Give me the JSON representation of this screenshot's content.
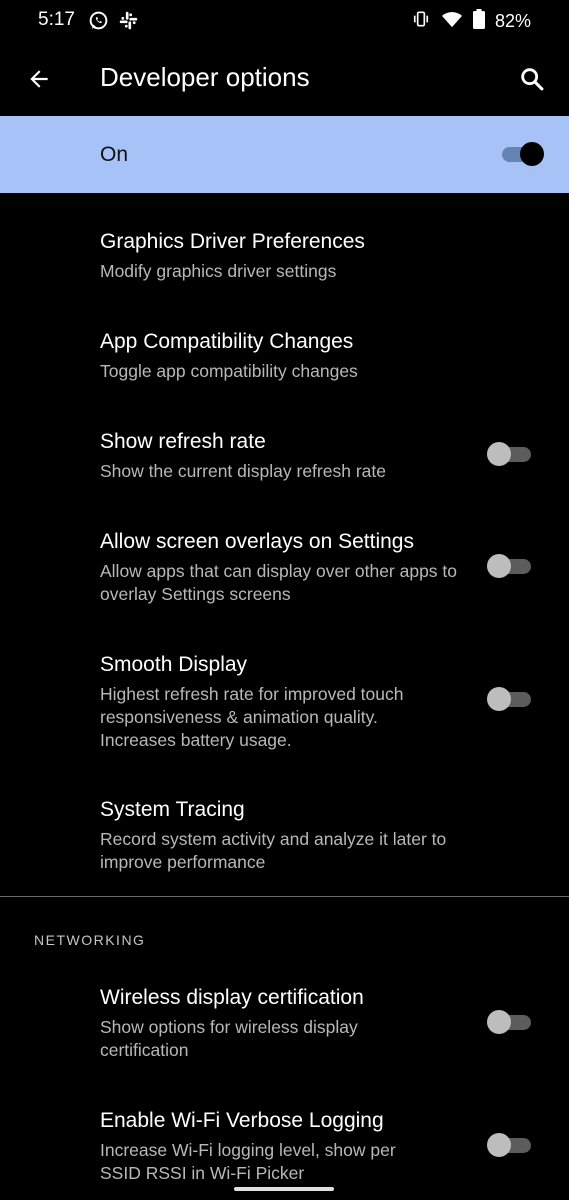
{
  "status_bar": {
    "time": "5:17",
    "battery": "82%",
    "left_icons": [
      "whatsapp-icon",
      "slack-icon"
    ],
    "right_icons": [
      "vibrate-icon",
      "wifi-icon",
      "battery-icon"
    ]
  },
  "app_bar": {
    "title": "Developer options",
    "back_icon": "back-arrow-icon",
    "search_icon": "search-icon"
  },
  "master_switch": {
    "label": "On",
    "checked": true,
    "background": "#a6c2f6"
  },
  "items": [
    {
      "title": "Graphics Driver Preferences",
      "subtitle": "Modify graphics driver settings",
      "has_toggle": false
    },
    {
      "title": "App Compatibility Changes",
      "subtitle": "Toggle app compatibility changes",
      "has_toggle": false
    },
    {
      "title": "Show refresh rate",
      "subtitle": "Show the current display refresh rate",
      "has_toggle": true,
      "checked": false
    },
    {
      "title": "Allow screen overlays on Settings",
      "subtitle": "Allow apps that can display over other apps to overlay Settings screens",
      "has_toggle": true,
      "checked": false
    },
    {
      "title": "Smooth Display",
      "subtitle": "Highest refresh rate for improved touch responsiveness & animation quality. Increases battery usage.",
      "has_toggle": true,
      "checked": false
    },
    {
      "title": "System Tracing",
      "subtitle": "Record system activity and analyze it later to improve performance",
      "has_toggle": false
    }
  ],
  "networking": {
    "header": "NETWORKING",
    "items": [
      {
        "title": "Wireless display certification",
        "subtitle": "Show options for wireless display certification",
        "has_toggle": true,
        "checked": false
      },
      {
        "title": "Enable Wi-Fi Verbose Logging",
        "subtitle": "Increase Wi-Fi logging level, show per SSID RSSI in Wi-Fi Picker",
        "has_toggle": true,
        "checked": false
      }
    ]
  }
}
